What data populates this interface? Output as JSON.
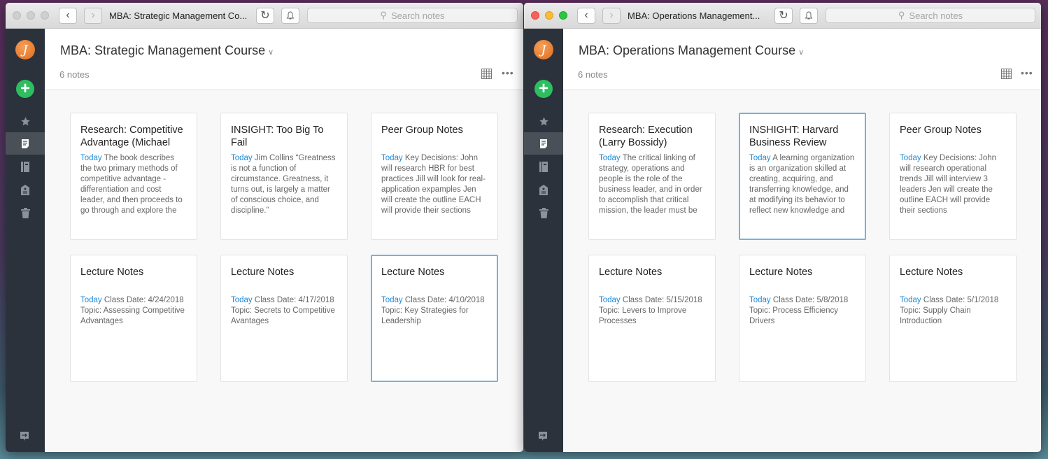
{
  "colors": {
    "accent": "#2dbe60",
    "link": "#1f8ad6",
    "sidebar": "#2b323b",
    "selected_border": "#6eb3e8"
  },
  "search": {
    "placeholder": "Search notes"
  },
  "windows": [
    {
      "window_title": "MBA: Strategic Management Co...",
      "notebook_title": "MBA: Strategic Management Course",
      "note_count": "6 notes",
      "avatar_letter": "J",
      "notes": [
        {
          "title": "Research: Competitive Advantage (Michael E....",
          "date": "Today",
          "snippet": "The book describes the two primary methods of competitive advantage - differentiation and cost leader, and then proceeds to go through and explore the various components of the v..."
        },
        {
          "title": "INSIGHT: Too Big To Fail",
          "date": "Today",
          "snippet": "Jim Collins “Greatness is not a function of circumstance. Greatness, it turns out, is largely a matter of conscious choice, and discipline.”"
        },
        {
          "title": "Peer Group Notes",
          "date": "Today",
          "snippet": "Key Decisions: John will research HBR for best practices Jill will look for real-application expamples Jen will create the outline EACH will provide their sections"
        },
        {
          "title": "Lecture Notes",
          "date": "Today",
          "snippet": "Class Date: 4/24/2018 Topic: Assessing Competitive Advantages"
        },
        {
          "title": "Lecture Notes",
          "date": "Today",
          "snippet": "Class Date: 4/17/2018 Topic: Secrets to Competitive Avantages"
        },
        {
          "title": "Lecture Notes",
          "date": "Today",
          "snippet": "Class Date: 4/10/2018 Topic: Key Strategies for Leadership"
        }
      ]
    },
    {
      "window_title": "MBA: Operations Management...",
      "notebook_title": "MBA: Operations Management Course",
      "note_count": "6 notes",
      "avatar_letter": "J",
      "notes": [
        {
          "title": "Research: Execution (Larry Bossidy)",
          "date": "Today",
          "snippet": "The critical linking of strategy, operations and people is the role of the business leader, and in order to accomplish that critical mission, the leader must be meaningfully involved in tho..."
        },
        {
          "title": "INSHIGHT: Harvard Business Review",
          "date": "Today",
          "snippet": "A learning organization is an organization skilled at creating, acquiring, and transferring knowledge, and at modifying its behavior to reflect new knowledge and insights. This definition begi..."
        },
        {
          "title": "Peer Group Notes",
          "date": "Today",
          "snippet": "Key Decisions: John will research operational trends Jill will interview 3 leaders Jen will create the outline EACH will provide their sections"
        },
        {
          "title": "Lecture Notes",
          "date": "Today",
          "snippet": "Class Date: 5/15/2018 Topic: Levers to Improve Processes"
        },
        {
          "title": "Lecture Notes",
          "date": "Today",
          "snippet": "Class Date: 5/8/2018 Topic: Process Efficiency Drivers"
        },
        {
          "title": "Lecture Notes",
          "date": "Today",
          "snippet": "Class Date: 5/1/2018 Topic: Supply Chain Introduction"
        }
      ]
    }
  ]
}
